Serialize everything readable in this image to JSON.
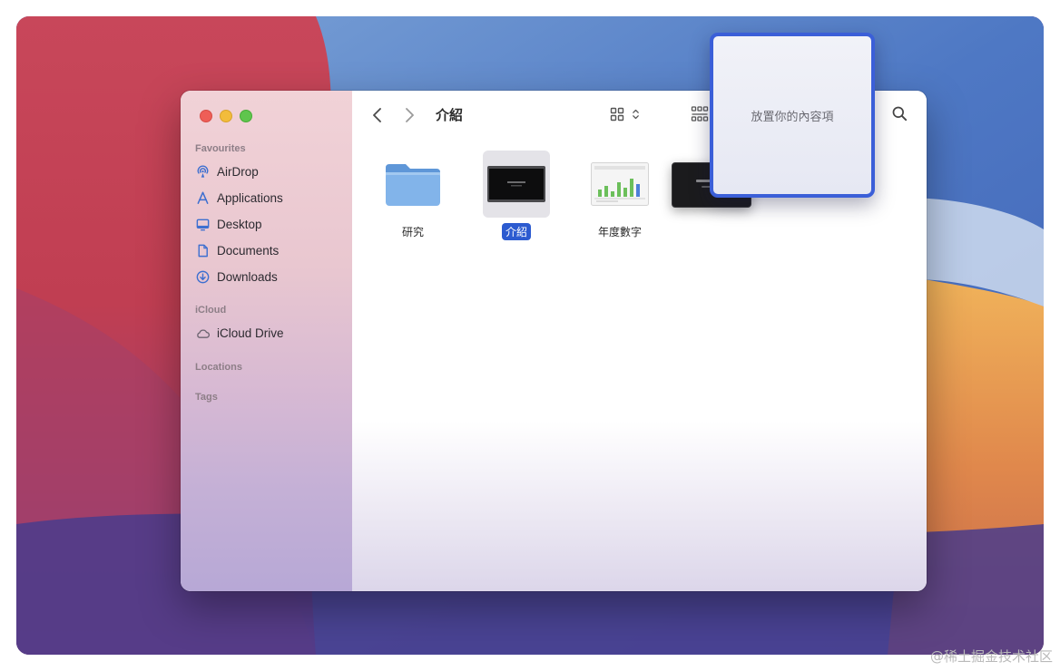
{
  "window": {
    "title": "介紹"
  },
  "sidebar": {
    "sections": {
      "favourites": "Favourites",
      "icloud": "iCloud",
      "locations": "Locations",
      "tags": "Tags"
    },
    "favourites_items": [
      {
        "label": "AirDrop",
        "icon": "airdrop-icon"
      },
      {
        "label": "Applications",
        "icon": "applications-icon"
      },
      {
        "label": "Desktop",
        "icon": "desktop-icon"
      },
      {
        "label": "Documents",
        "icon": "document-icon"
      },
      {
        "label": "Downloads",
        "icon": "download-icon"
      }
    ],
    "icloud_items": [
      {
        "label": "iCloud Drive",
        "icon": "cloud-icon"
      }
    ]
  },
  "files": [
    {
      "name": "研究",
      "kind": "folder"
    },
    {
      "name": "介紹",
      "kind": "presentation",
      "selected": true
    },
    {
      "name": "年度數字",
      "kind": "spreadsheet"
    }
  ],
  "drop_zone": {
    "label": "放置你的內容項"
  },
  "watermark": "@稀土掘金技术社区",
  "colors": {
    "accent": "#2c5bd0",
    "drop_border": "#3b5fd8",
    "folder": "#7fb2ea"
  }
}
